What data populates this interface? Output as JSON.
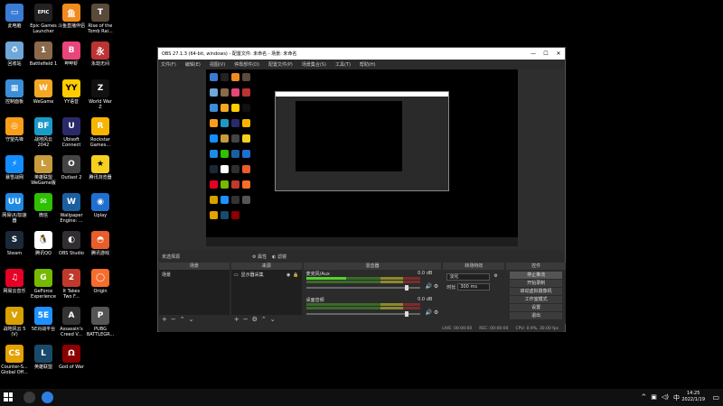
{
  "desktop_icons": [
    {
      "label": "此电脑",
      "icon": "computer-icon",
      "color": "#3a7bd5",
      "glyph": "▭"
    },
    {
      "label": "Epic Games\nLauncher",
      "icon": "epic-games-icon",
      "color": "#222",
      "glyph": "EPIC"
    },
    {
      "label": "斗鱼直播伴侣",
      "icon": "douyu-icon",
      "color": "#f28b1e",
      "glyph": "鱼"
    },
    {
      "label": "Rise of the\nTomb Rai...",
      "icon": "tomb-raider-icon",
      "color": "#5a4a3a",
      "glyph": "T"
    },
    {
      "label": "回收站",
      "icon": "recycle-bin-icon",
      "color": "#6ea7d8",
      "glyph": "♻"
    },
    {
      "label": "Battlefield 1",
      "icon": "battlefield-icon",
      "color": "#8a6a4a",
      "glyph": "1"
    },
    {
      "label": "哔哔虾",
      "icon": "app-icon",
      "color": "#e9457a",
      "glyph": "B"
    },
    {
      "label": "永劫无间",
      "icon": "naraka-icon",
      "color": "#b33",
      "glyph": "永"
    },
    {
      "label": "控制面板",
      "icon": "control-panel-icon",
      "color": "#3a8fd8",
      "glyph": "▦"
    },
    {
      "label": "WeGame",
      "icon": "wegame-icon",
      "color": "#f5a623",
      "glyph": "W"
    },
    {
      "label": "YY语音",
      "icon": "yy-icon",
      "color": "#ffcc00",
      "glyph": "YY"
    },
    {
      "label": "World War\nZ",
      "icon": "world-war-z-icon",
      "color": "#111",
      "glyph": "Z"
    },
    {
      "label": "守望先锋",
      "icon": "overwatch-icon",
      "color": "#f99e1a",
      "glyph": "◎"
    },
    {
      "label": "战地风云\n2042",
      "icon": "bf2042-icon",
      "color": "#1a9ac6",
      "glyph": "BF"
    },
    {
      "label": "Ubisoft\nConnect",
      "icon": "ubisoft-icon",
      "color": "#2a2a6a",
      "glyph": "U"
    },
    {
      "label": "Rockstar\nGames...",
      "icon": "rockstar-icon",
      "color": "#f7b500",
      "glyph": "R"
    },
    {
      "label": "暴雪战网",
      "icon": "battlenet-icon",
      "color": "#148eff",
      "glyph": "⚡"
    },
    {
      "label": "英雄联盟\nWeGame版",
      "icon": "lol-icon",
      "color": "#c89b3c",
      "glyph": "L"
    },
    {
      "label": "Outlast 2",
      "icon": "outlast-icon",
      "color": "#444",
      "glyph": "O"
    },
    {
      "label": "腾讯浏览器",
      "icon": "browser-icon",
      "color": "#f5d020",
      "glyph": "★"
    },
    {
      "label": "网易UU加速\n器",
      "icon": "uu-icon",
      "color": "#1e8ae6",
      "glyph": "UU"
    },
    {
      "label": "微信",
      "icon": "wechat-icon",
      "color": "#2dc100",
      "glyph": "✉"
    },
    {
      "label": "Wallpaper\nEngine: ...",
      "icon": "wallpaper-engine-icon",
      "color": "#1b5fa0",
      "glyph": "W"
    },
    {
      "label": "Uplay",
      "icon": "uplay-icon",
      "color": "#1f6fd0",
      "glyph": "◉"
    },
    {
      "label": "Steam",
      "icon": "steam-icon",
      "color": "#1b2838",
      "glyph": "S"
    },
    {
      "label": "腾讯QQ",
      "icon": "qq-icon",
      "color": "#fff",
      "glyph": "🐧"
    },
    {
      "label": "OBS Studio",
      "icon": "obs-icon",
      "color": "#302e31",
      "glyph": "◐"
    },
    {
      "label": "腾讯游戏",
      "icon": "tencent-game-icon",
      "color": "#e85d2a",
      "glyph": "◓"
    },
    {
      "label": "网易云音乐",
      "icon": "netease-music-icon",
      "color": "#e60026",
      "glyph": "♫"
    },
    {
      "label": "GeForce\nExperience",
      "icon": "geforce-icon",
      "color": "#76b900",
      "glyph": "G"
    },
    {
      "label": "It Takes\nTwo F...",
      "icon": "it-takes-two-icon",
      "color": "#c0392b",
      "glyph": "2"
    },
    {
      "label": "Origin",
      "icon": "origin-icon",
      "color": "#f56c2d",
      "glyph": "◯"
    },
    {
      "label": "战地风云 5\n(V)",
      "icon": "bfv-icon",
      "color": "#d8a000",
      "glyph": "V"
    },
    {
      "label": "5E对战平台",
      "icon": "5e-icon",
      "color": "#1e90ff",
      "glyph": "5E"
    },
    {
      "label": "Assassin's\nCreed V...",
      "icon": "assassins-creed-icon",
      "color": "#333",
      "glyph": "A"
    },
    {
      "label": "PUBG\nBATTLEGR...",
      "icon": "pubg-icon",
      "color": "#555",
      "glyph": "P"
    },
    {
      "label": "Counter-S...\nGlobal Off...",
      "icon": "csgo-icon",
      "color": "#e6a100",
      "glyph": "CS"
    },
    {
      "label": "英雄联盟",
      "icon": "lol2-icon",
      "color": "#1a4a6a",
      "glyph": "L"
    },
    {
      "label": "God of War",
      "icon": "god-of-war-icon",
      "color": "#8b0000",
      "glyph": "Ω"
    }
  ],
  "obs": {
    "title": "OBS 27.1.3 (64-bit, windows) - 配置文件: 未命名 - 场景: 未命名",
    "menu": [
      "文件(F)",
      "编辑(E)",
      "视图(V)",
      "停靠部件(D)",
      "配置文件(P)",
      "场景集合(S)",
      "工具(T)",
      "帮助(H)"
    ],
    "source_bar": {
      "label": "未选择源",
      "props": "⚙ 属性",
      "filters": "◐ 滤镜"
    },
    "scenes": {
      "header": "场景",
      "items": [
        "场景"
      ]
    },
    "sources": {
      "header": "来源",
      "items": [
        "显示器采集"
      ]
    },
    "mixer": {
      "header": "混音器",
      "tracks": [
        {
          "name": "麦克风/Aux",
          "db": "0.0 dB"
        },
        {
          "name": "桌面音频",
          "db": "0.0 dB"
        }
      ]
    },
    "transitions": {
      "header": "转场特效",
      "type": "淡化",
      "duration_label": "时长",
      "duration": "300 ms"
    },
    "controls": {
      "header": "控件",
      "buttons": [
        "停止推流",
        "开始录制",
        "启动虚拟摄像机",
        "工作室模式",
        "设置",
        "退出"
      ]
    },
    "status": {
      "live": "LIVE: 00:00:00",
      "rec": "REC: 00:00:00",
      "cpu": "CPU: 0.9%, 30.00 fps"
    }
  },
  "taskbar": {
    "time": "14:25",
    "date": "2022/1/19",
    "tray_lang": "中"
  }
}
